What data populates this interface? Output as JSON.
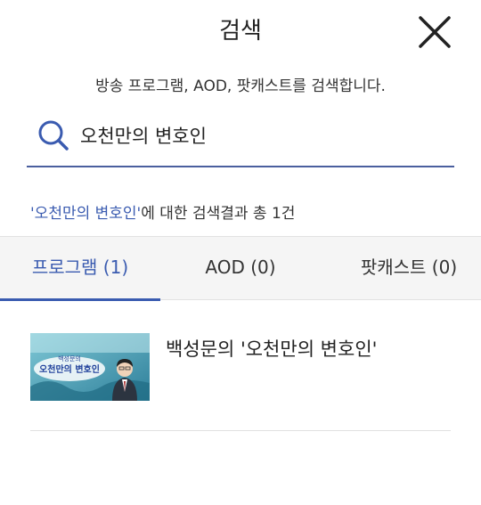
{
  "header": {
    "title": "검색"
  },
  "search": {
    "description": "방송 프로그램, AOD, 팟캐스트를 검색합니다.",
    "query": "오천만의 변호인"
  },
  "summary": {
    "keyword": "'오천만의 변호인'",
    "suffix": "에 대한 검색결과 총 1건"
  },
  "tabs": [
    {
      "label": "프로그램 (1)",
      "selected": true
    },
    {
      "label": "AOD (0)",
      "selected": false
    },
    {
      "label": "팟캐스트 (0)",
      "selected": false
    }
  ],
  "results": [
    {
      "title": "백성문의 '오천만의 변호인'",
      "thumbnail": {
        "line1": "백성문의",
        "line2": "오천만의 변호인"
      }
    }
  ],
  "colors": {
    "accent": "#3a5bb0",
    "underline": "#4a5f9e",
    "tab_bg": "#f5f5f5"
  }
}
